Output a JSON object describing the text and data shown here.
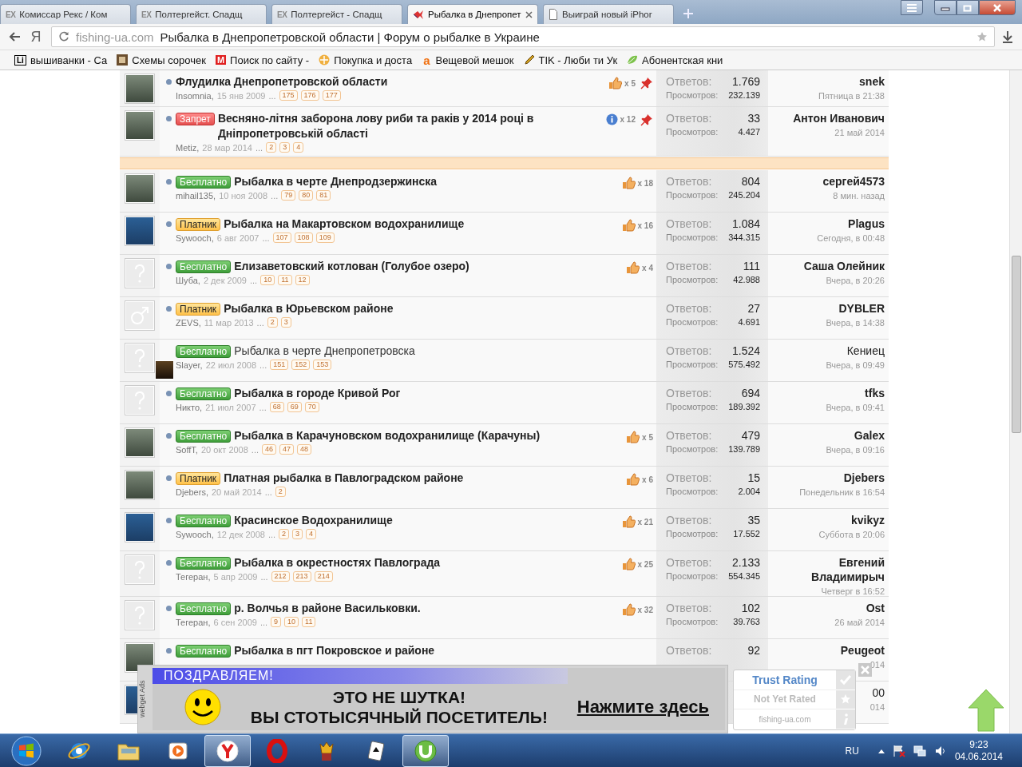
{
  "browser": {
    "tabs": [
      {
        "title": "Комиссар Рекс / Ком",
        "badge": "EX",
        "kind": "ex",
        "selected": false
      },
      {
        "title": "Полтергейст. Спадщ",
        "badge": "EX",
        "kind": "ex",
        "selected": false
      },
      {
        "title": "Полтергейст - Спадщ",
        "badge": "EX",
        "kind": "ex",
        "selected": false
      },
      {
        "title": "Рыбалка в Днепропет",
        "kind": "site",
        "selected": true
      },
      {
        "title": "Выиграй новый iPhor",
        "kind": "page",
        "selected": false
      }
    ],
    "brand_mark": "Я",
    "address": {
      "domain": "fishing-ua.com",
      "title": "Рыбалка в Днепропетровской области | Форум о рыбалке в Украине"
    },
    "bookmarks": [
      {
        "label": "вышиванки - Са",
        "badge": "Li",
        "kind": "li"
      },
      {
        "label": "Схемы сорочек",
        "kind": "picture"
      },
      {
        "label": "Поиск по сайту -",
        "badge": "M",
        "kind": "m"
      },
      {
        "label": "Покупка и доста",
        "kind": "coin"
      },
      {
        "label": "Вещевой мешок",
        "badge": "а",
        "kind": "a"
      },
      {
        "label": "TIK - Люби ти Ук",
        "kind": "pen"
      },
      {
        "label": "Абонентская кни",
        "kind": "leaf"
      }
    ]
  },
  "sticky_threads": [
    {
      "avatar": {
        "kind": "photo"
      },
      "unread": true,
      "title": "Флудилка Днепропетровской области",
      "author": "Insomnia,",
      "date": "15 янв 2009",
      "more": "...",
      "pages": [
        "175",
        "176",
        "177"
      ],
      "badge": {
        "kind": "like",
        "count": "x 5"
      },
      "sticky": true,
      "replies_label": "Ответов:",
      "replies": "1.769",
      "views_label": "Просмотров:",
      "views": "232.139",
      "last_user": "snek",
      "last_time": "Пятница в 21:38"
    },
    {
      "avatar": {
        "kind": "photo"
      },
      "unread": true,
      "prefix": {
        "kind": "ban",
        "label": "Запрет"
      },
      "title": "Весняно-літня заборона лову риби та раків у 2014 році в Дніпропетровській області",
      "author": "Metiz,",
      "date": "28 мар 2014",
      "more": "...",
      "pages": [
        "2",
        "3",
        "4"
      ],
      "badge": {
        "kind": "info",
        "count": "x 12"
      },
      "sticky": true,
      "replies_label": "Ответов:",
      "replies": "33",
      "views_label": "Просмотров:",
      "views": "4.427",
      "last_user": "Антон Иванович",
      "last_time": "21 май 2014"
    }
  ],
  "threads": [
    {
      "avatar": {
        "kind": "photo"
      },
      "unread": true,
      "prefix": {
        "kind": "free",
        "label": "Бесплатно"
      },
      "title": "Рыбалка в черте Днепродзержинска",
      "author": "mihail135,",
      "date": "10 ноя 2008",
      "more": "...",
      "pages": [
        "79",
        "80",
        "81"
      ],
      "badge": {
        "kind": "like",
        "count": "x 18"
      },
      "replies_label": "Ответов:",
      "replies": "804",
      "views_label": "Просмотров:",
      "views": "245.204",
      "last_user": "сергей4573",
      "last_time": "8 мин. назад"
    },
    {
      "avatar": {
        "kind": "logo"
      },
      "unread": true,
      "prefix": {
        "kind": "paid",
        "label": "Платник"
      },
      "title": "Рыбалка на Макартовском водохранилище",
      "author": "Sywooch,",
      "date": "6 авг 2007",
      "more": "...",
      "pages": [
        "107",
        "108",
        "109"
      ],
      "badge": {
        "kind": "like",
        "count": "x 16"
      },
      "replies_label": "Ответов:",
      "replies": "1.084",
      "views_label": "Просмотров:",
      "views": "344.315",
      "last_user": "Plagus",
      "last_time": "Сегодня, в 00:48"
    },
    {
      "avatar": {
        "kind": "unknown"
      },
      "unread": true,
      "prefix": {
        "kind": "free",
        "label": "Бесплатно"
      },
      "title": "Елизаветовский котлован (Голубое озеро)",
      "author": "Шуба,",
      "date": "2 дек 2009",
      "more": "...",
      "pages": [
        "10",
        "11",
        "12"
      ],
      "badge": {
        "kind": "like",
        "count": "x 4"
      },
      "replies_label": "Ответов:",
      "replies": "111",
      "views_label": "Просмотров:",
      "views": "42.988",
      "last_user": "Саша Олейник",
      "last_time": "Вчера, в 20:26"
    },
    {
      "avatar": {
        "kind": "male"
      },
      "unread": true,
      "prefix": {
        "kind": "paid",
        "label": "Платник"
      },
      "title": "Рыбалка в Юрьевском районе",
      "author": "ZEVS,",
      "date": "11 мар 2013",
      "more": "...",
      "pages": [
        "2",
        "3"
      ],
      "replies_label": "Ответов:",
      "replies": "27",
      "views_label": "Просмотров:",
      "views": "4.691",
      "last_user": "DYBLER",
      "last_time": "Вчера, в 14:38"
    },
    {
      "avatar": {
        "kind": "unknown"
      },
      "thumbnail": true,
      "unread": false,
      "prefix": {
        "kind": "free",
        "label": "Бесплатно"
      },
      "title": "Рыбалка в черте Днепропетровска",
      "author": "Slayer,",
      "date": "22 июл 2008",
      "more": "...",
      "pages": [
        "151",
        "152",
        "153"
      ],
      "replies_label": "Ответов:",
      "replies": "1.524",
      "views_label": "Просмотров:",
      "views": "575.492",
      "last_user": "Кениец",
      "last_time": "Вчера, в 09:49"
    },
    {
      "avatar": {
        "kind": "unknown"
      },
      "unread": true,
      "prefix": {
        "kind": "free",
        "label": "Бесплатно"
      },
      "title": "Рыбалка в городе Кривой Рог",
      "author": "Никто,",
      "date": "21 июл 2007",
      "more": "...",
      "pages": [
        "68",
        "69",
        "70"
      ],
      "replies_label": "Ответов:",
      "replies": "694",
      "views_label": "Просмотров:",
      "views": "189.392",
      "last_user": "tfks",
      "last_time": "Вчера, в 09:41"
    },
    {
      "avatar": {
        "kind": "photo"
      },
      "unread": true,
      "prefix": {
        "kind": "free",
        "label": "Бесплатно"
      },
      "title": "Рыбалка в Карачуновском водохранилище (Карачуны)",
      "author": "SoffT,",
      "date": "20 окт 2008",
      "more": "...",
      "pages": [
        "46",
        "47",
        "48"
      ],
      "badge": {
        "kind": "like",
        "count": "x 5"
      },
      "replies_label": "Ответов:",
      "replies": "479",
      "views_label": "Просмотров:",
      "views": "139.789",
      "last_user": "Galex",
      "last_time": "Вчера, в 09:16"
    },
    {
      "avatar": {
        "kind": "photo"
      },
      "unread": true,
      "prefix": {
        "kind": "paid",
        "label": "Платник"
      },
      "title": "Платная рыбалка в Павлоградском районе",
      "author": "Djebers,",
      "date": "20 май 2014",
      "more": "...",
      "pages": [
        "2"
      ],
      "badge": {
        "kind": "like",
        "count": "x 6"
      },
      "replies_label": "Ответов:",
      "replies": "15",
      "views_label": "Просмотров:",
      "views": "2.004",
      "last_user": "Djebers",
      "last_time": "Понедельник в 16:54"
    },
    {
      "avatar": {
        "kind": "logo"
      },
      "unread": true,
      "prefix": {
        "kind": "free",
        "label": "Бесплатно"
      },
      "title": "Красинское Водохранилище",
      "author": "Sywooch,",
      "date": "12 дек 2008",
      "more": "...",
      "pages": [
        "2",
        "3",
        "4"
      ],
      "badge": {
        "kind": "like",
        "count": "x 21"
      },
      "replies_label": "Ответов:",
      "replies": "35",
      "views_label": "Просмотров:",
      "views": "17.552",
      "last_user": "kvikyz",
      "last_time": "Суббота в 20:06"
    },
    {
      "avatar": {
        "kind": "unknown"
      },
      "unread": true,
      "prefix": {
        "kind": "free",
        "label": "Бесплатно"
      },
      "title": "Рыбалка в окрестностях Павлограда",
      "author": "Тегеран,",
      "date": "5 апр 2009",
      "more": "...",
      "pages": [
        "212",
        "213",
        "214"
      ],
      "badge": {
        "kind": "like",
        "count": "x 25"
      },
      "replies_label": "Ответов:",
      "replies": "2.133",
      "views_label": "Просмотров:",
      "views": "554.345",
      "last_user": "Евгений Владимирыч",
      "last_time": "Четверг в 16:52"
    },
    {
      "avatar": {
        "kind": "unknown"
      },
      "unread": true,
      "prefix": {
        "kind": "free",
        "label": "Бесплатно"
      },
      "title": "р. Волчья в районе Васильковки.",
      "author": "Тегеран,",
      "date": "6 сен 2009",
      "more": "...",
      "pages": [
        "9",
        "10",
        "11"
      ],
      "badge": {
        "kind": "like",
        "count": "x 32"
      },
      "replies_label": "Ответов:",
      "replies": "102",
      "views_label": "Просмотров:",
      "views": "39.763",
      "last_user": "Ost",
      "last_time": "26 май 2014"
    },
    {
      "avatar": {
        "kind": "photo"
      },
      "unread": true,
      "prefix": {
        "kind": "free",
        "label": "Бесплатно"
      },
      "title": "Рыбалка в пгт Покровское и районе",
      "replies_label": "Ответов:",
      "replies": "92",
      "last_user": "Peugeot",
      "last_time": "014"
    },
    {
      "avatar": {
        "kind": "logo"
      },
      "last_user": "00",
      "last_time": "014"
    }
  ],
  "ad": {
    "side_label": "webget Ads",
    "banner": "ПОЗДРАВЛЯЕМ!",
    "lines": [
      "ЭТО НЕ ШУТКА!",
      "ВЫ СТОТЫСЯЧНЫЙ ПОСЕТИТЕЛЬ!"
    ],
    "link": "Нажмите здесь",
    "trust": {
      "title": "Trust Rating",
      "rating": "Not Yet Rated",
      "site": "fishing-ua.com"
    }
  },
  "taskbar": {
    "apps": [
      {
        "kind": "e",
        "active": false
      },
      {
        "kind": "folder",
        "active": false
      },
      {
        "kind": "media",
        "active": false
      },
      {
        "kind": "y",
        "active": true
      },
      {
        "kind": "o",
        "active": false
      },
      {
        "kind": "king",
        "active": false
      },
      {
        "kind": "cards",
        "active": false
      },
      {
        "kind": "u",
        "active": true
      }
    ],
    "language": "RU",
    "time": "9:23",
    "date": "04.06.2014"
  }
}
